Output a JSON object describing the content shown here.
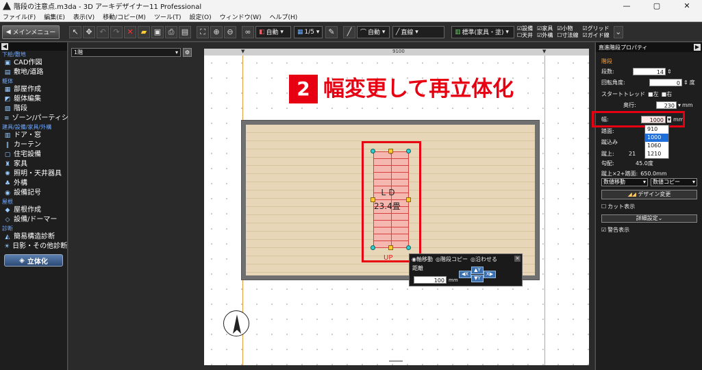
{
  "window": {
    "title": "階段の注意点.m3da - 3D アーキデザイナー11 Professional",
    "min": "—",
    "max": "▢",
    "close": "✕"
  },
  "menu": [
    "ファイル(F)",
    "編集(E)",
    "表示(V)",
    "移動/コピー(M)",
    "ツール(T)",
    "設定(O)",
    "ウィンドウ(W)",
    "ヘルプ(H)"
  ],
  "toolbar": {
    "main_menu": "メインメニュー",
    "snap_mode": "自動",
    "scale": "1/5",
    "line_mode": "自動",
    "line_type": "直線",
    "display_mode": "標準(家具・塗)",
    "checks": [
      {
        "a": "設備",
        "b": "天井"
      },
      {
        "a": "家具",
        "b": "外構"
      },
      {
        "a": "小物",
        "b": "寸法線"
      },
      {
        "a": "グリッド",
        "b": "ガイド線"
      }
    ]
  },
  "left": {
    "sections": [
      {
        "cat": "下絵/敷地",
        "items": [
          {
            "icon": "▣",
            "label": "CAD作図"
          },
          {
            "icon": "▤",
            "label": "敷地/道路"
          }
        ]
      },
      {
        "cat": "躯体",
        "items": [
          {
            "icon": "▦",
            "label": "部屋作成"
          },
          {
            "icon": "◩",
            "label": "躯体編集"
          },
          {
            "icon": "▨",
            "label": "階段"
          },
          {
            "icon": "≡",
            "label": "ゾーン/パーティション"
          }
        ]
      },
      {
        "cat": "建具/設備/家具/外構",
        "items": [
          {
            "icon": "▥",
            "label": "ドア・窓"
          },
          {
            "icon": "‖",
            "label": "カーテン"
          },
          {
            "icon": "▢",
            "label": "住宅設備"
          },
          {
            "icon": "♜",
            "label": "家具"
          },
          {
            "icon": "✺",
            "label": "照明・天井器具"
          },
          {
            "icon": "♣",
            "label": "外構"
          },
          {
            "icon": "◉",
            "label": "設備記号"
          }
        ]
      },
      {
        "cat": "屋根",
        "items": [
          {
            "icon": "◆",
            "label": "屋根作成"
          },
          {
            "icon": "◇",
            "label": "設備/ドーマー"
          }
        ]
      },
      {
        "cat": "診断",
        "items": [
          {
            "icon": "◭",
            "label": "簡易構造診断"
          },
          {
            "icon": "☀",
            "label": "日影・その他診断"
          }
        ]
      }
    ],
    "rittai_button": "立体化"
  },
  "canvas": {
    "layer": "1階",
    "ruler_label": "9100",
    "room_label": "ＬＤ",
    "room_area": "23.4畳",
    "up_label": "UP",
    "stair_top_mark": "↑",
    "popup": {
      "options": [
        "軸移動",
        "階段コピー",
        "沿わせる"
      ],
      "distance_label": "距離",
      "distance_value": "100",
      "distance_unit": "mm"
    },
    "annotation": {
      "number": "2",
      "text": "幅変更して再立体化"
    }
  },
  "right": {
    "title": "直進階段プロパティ",
    "section": "階段",
    "rows": {
      "steps_label": "段数:",
      "steps_value": "14",
      "angle_label": "回転角度:",
      "angle_value": "0",
      "angle_unit": "度",
      "start_label": "スタートトレッド",
      "start_left": "左",
      "start_right": "右",
      "depth_label": "奥行:",
      "depth_value": "230",
      "depth_unit": "mm",
      "width_label": "幅:",
      "width_value": "1000",
      "width_unit": "mm",
      "blade_label": "踏面:",
      "recess_label": "蹴込み",
      "rise_label": "蹴上:",
      "rise_value": "21",
      "slope_label": "勾配:",
      "slope_value": "45.0度",
      "total_label": "蹴上×2+踏面:",
      "total_value": "650.0mm"
    },
    "width_options": [
      "910",
      "1000",
      "1060",
      "1210"
    ],
    "selected_option": "1000",
    "move_select": "数値移動",
    "copy_select": "数値コピー",
    "design_btn": "デザイン変更",
    "cut_label": "カット表示",
    "detail_btn": "詳細設定",
    "warn_label": "警告表示"
  },
  "colors": {
    "accent": "#e60012",
    "highlight": "#1e6fd9",
    "floor": "#e8d6b8",
    "wall": "#707070"
  }
}
